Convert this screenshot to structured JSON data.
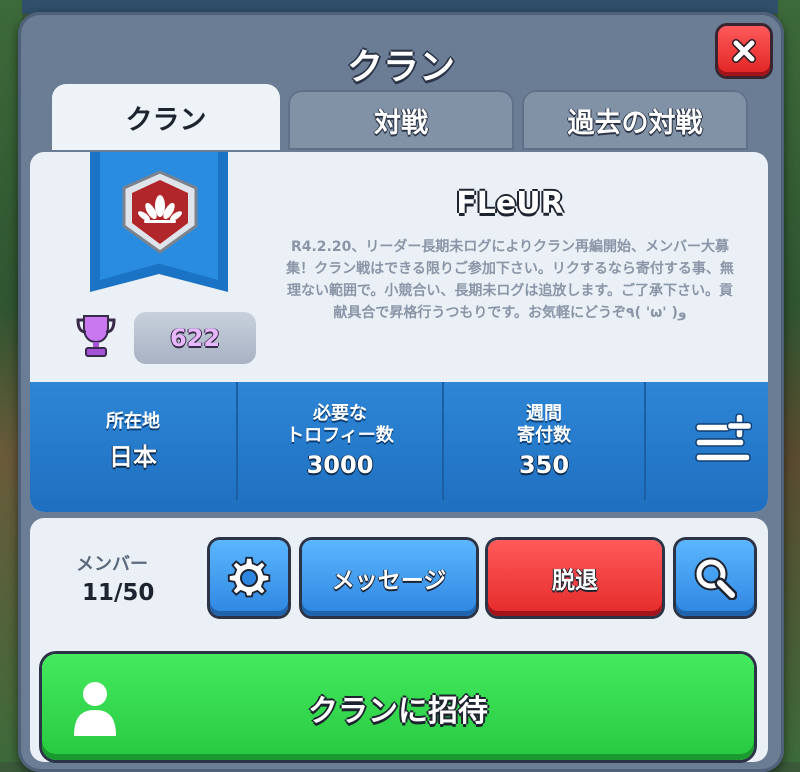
{
  "header": {
    "title": "クラン",
    "close_icon": "close-icon"
  },
  "tabs": [
    {
      "label": "クラン",
      "active": true
    },
    {
      "label": "対戦",
      "active": false
    },
    {
      "label": "過去の対戦",
      "active": false
    }
  ],
  "clan": {
    "name": "FLeUR",
    "trophies": "622",
    "description": "R4.2.20、リーダー長期未ログによりクラン再編開始、メンバー大募集！クラン戦はできる限りご参加下さい。リクするなら寄付する事、無理ない範囲で。小競合い、長期未ログは追放します。ご了承下さい。貢献具合で昇格行うつもりです。お気軽にどうぞ٩( 'ω' )و"
  },
  "stats": {
    "location_label": "所在地",
    "location_value": "日本",
    "required_label_1": "必要な",
    "required_label_2": "トロフィー数",
    "required_value": "3000",
    "weekly_label_1": "週間",
    "weekly_label_2": "寄付数",
    "weekly_value": "350"
  },
  "members": {
    "label": "メンバー",
    "value": "11/50"
  },
  "actions": {
    "message_label": "メッセージ",
    "leave_label": "脱退",
    "invite_label": "クランに招待"
  },
  "colors": {
    "accent_blue": "#2e86d6",
    "leave_red": "#e52a2a",
    "invite_green": "#28c940",
    "panel": "#6b7d95"
  }
}
